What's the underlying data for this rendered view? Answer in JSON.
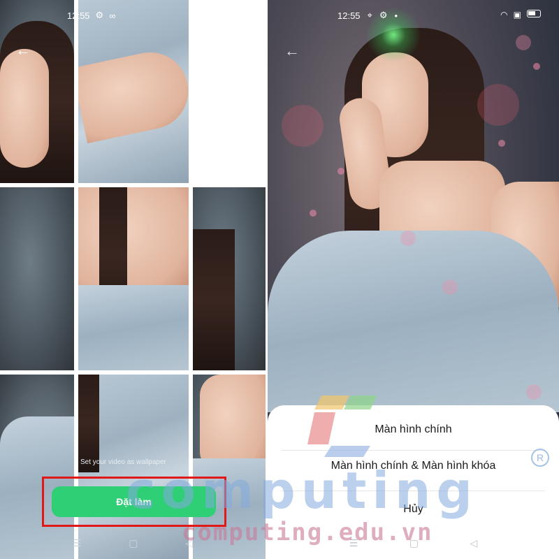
{
  "left_screen": {
    "status_time": "12:55",
    "hint_text": "Set your video as wallpaper",
    "set_button_label": "Đặt làm"
  },
  "right_screen": {
    "status_time": "12:55",
    "options": [
      {
        "label": "Màn hình chính"
      },
      {
        "label": "Màn hình chính & Màn hình khóa"
      },
      {
        "label": "Hủy"
      }
    ]
  },
  "watermark": {
    "brand": "computing",
    "site": "computing.edu.vn",
    "registered_mark": "R"
  },
  "colors": {
    "accent_green": "#2fcf76",
    "highlight_red": "#e01818",
    "sheet_bg": "#ffffff"
  }
}
